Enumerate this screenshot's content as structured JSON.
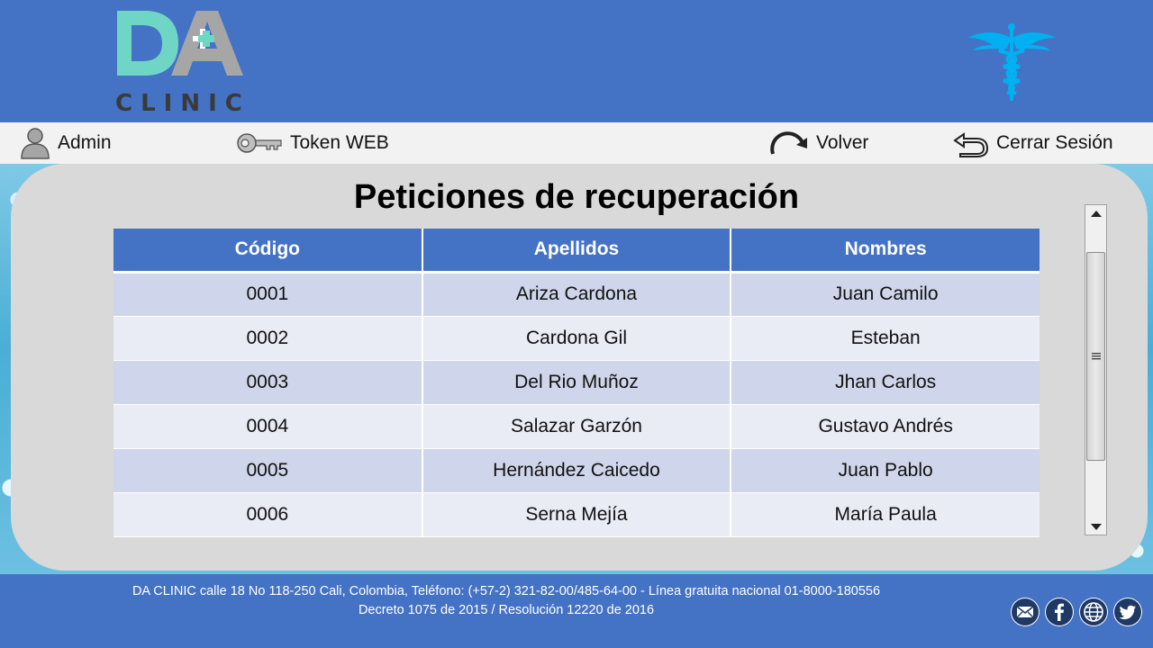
{
  "brand": {
    "logo_letters": "DA",
    "logo_word": "CLINIC"
  },
  "nav": {
    "admin": "Admin",
    "token": "Token WEB",
    "back": "Volver",
    "logout": "Cerrar Sesión"
  },
  "page": {
    "title": "Peticiones de recuperación"
  },
  "table": {
    "headers": [
      "Código",
      "Apellidos",
      "Nombres"
    ],
    "rows": [
      [
        "0001",
        "Ariza Cardona",
        "Juan Camilo"
      ],
      [
        "0002",
        "Cardona Gil",
        "Esteban"
      ],
      [
        "0003",
        "Del Rio Muñoz",
        "Jhan Carlos"
      ],
      [
        "0004",
        "Salazar Garzón",
        "Gustavo Andrés"
      ],
      [
        "0005",
        "Hernández Caicedo",
        "Juan Pablo"
      ],
      [
        "0006",
        "Serna Mejía",
        "María Paula"
      ]
    ]
  },
  "footer": {
    "line1": "DA CLINIC calle 18 No 118-250 Cali, Colombia, Teléfono:  (+57-2) 321-82-00/485-64-00 - Línea gratuita nacional 01-8000-180556",
    "line2": "Decreto 1075 de 2015 / Resolución 12220 de 2016"
  },
  "icons": {
    "user": "user-icon",
    "key": "key-icon",
    "redo": "redo-icon",
    "undo": "undo-icon",
    "caduceus": "caduceus-icon",
    "email": "email-icon",
    "facebook": "facebook-icon",
    "web": "globe-icon",
    "twitter": "twitter-icon"
  },
  "colors": {
    "primary": "#4472c4",
    "logo_teal": "#6fd6c6",
    "logo_gray": "#a6a6a6",
    "caduceus": "#00b0f0",
    "row_odd": "#cfd5ea",
    "row_even": "#e9ebf5"
  }
}
